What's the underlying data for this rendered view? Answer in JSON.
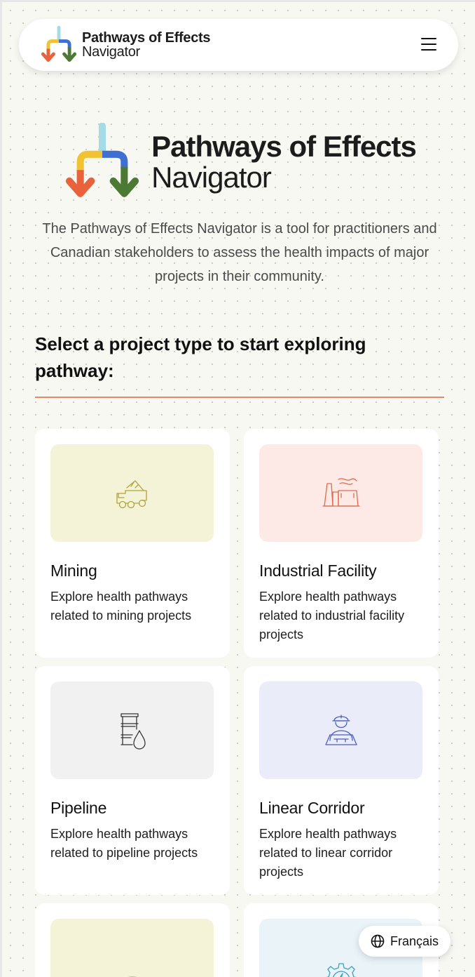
{
  "header": {
    "title_line1": "Pathways of Effects",
    "title_line2": "Navigator",
    "menu_icon": "hamburger-menu-icon"
  },
  "hero": {
    "title_line1": "Pathways of Effects",
    "title_line2": "Navigator",
    "description": "The Pathways of Effects Navigator is a tool for practitioners and Canadian stakeholders to assess the health impacts of major projects in their community."
  },
  "section": {
    "title": "Select a project type to start exploring pathway:"
  },
  "colors": {
    "divider": "#e8896a",
    "logo_orange": "#e8633c",
    "logo_yellow": "#f1c232",
    "logo_green": "#4c7a34",
    "logo_blue": "#3f6fd1",
    "logo_lightblue": "#a3dbe6"
  },
  "cards": [
    {
      "title": "Mining",
      "description": "Explore health pathways related to mining projects",
      "icon": "dump-truck-icon",
      "bg": "#f4f3d8",
      "icon_color": "#b0a437"
    },
    {
      "title": "Industrial Facility",
      "description": "Explore health pathways related to industrial facility projects",
      "icon": "factory-icon",
      "bg": "#fdeae6",
      "icon_color": "#e06a4c"
    },
    {
      "title": "Pipeline",
      "description": "Explore health pathways related to pipeline projects",
      "icon": "oil-barrel-icon",
      "bg": "#f1f1f1",
      "icon_color": "#333333"
    },
    {
      "title": "Linear Corridor",
      "description": "Explore health pathways related to linear corridor projects",
      "icon": "engineer-icon",
      "bg": "#eaedf9",
      "icon_color": "#4a5ec0"
    },
    {
      "title": "",
      "description": "",
      "icon": "radiation-icon",
      "bg": "#f4f3d8",
      "icon_color": "#b0a437"
    },
    {
      "title": "",
      "description": "",
      "icon": "energy-gear-icon",
      "bg": "#eaf4f8",
      "icon_color": "#3aa0c8"
    }
  ],
  "language_button": {
    "label": "Français",
    "icon": "globe-icon"
  }
}
